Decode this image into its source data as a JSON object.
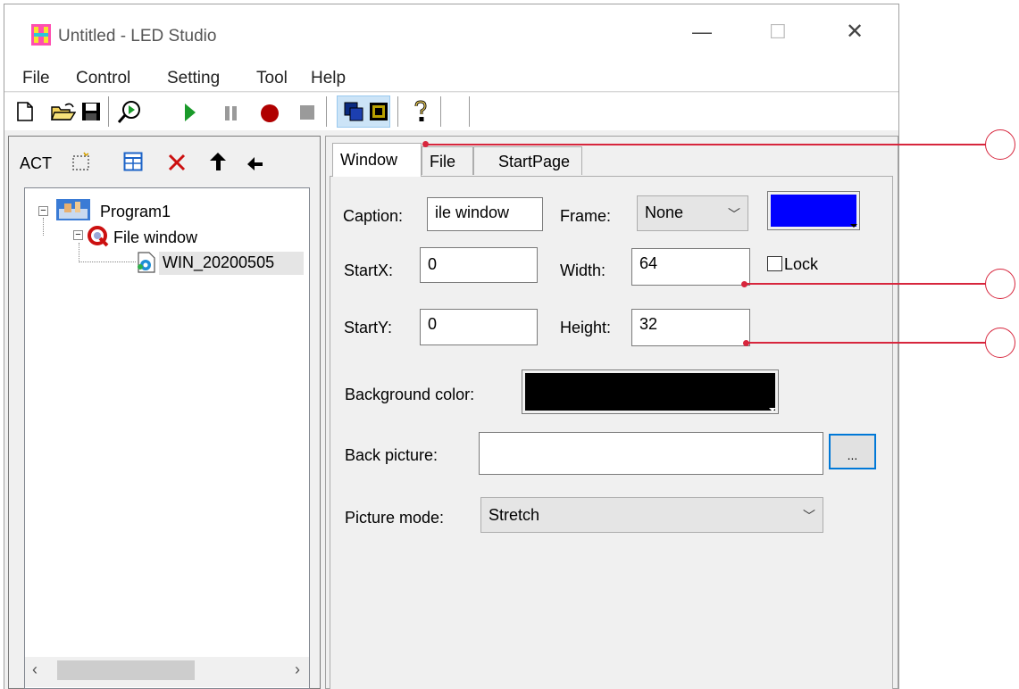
{
  "window": {
    "title": "Untitled - LED Studio",
    "minimize_glyph": "—",
    "maximize_glyph": "☐",
    "close_glyph": "✕"
  },
  "menu": [
    "File",
    "Control",
    "Setting",
    "Tool",
    "Help"
  ],
  "toolbar": {
    "icons": [
      "new-icon",
      "open-icon",
      "save-icon",
      "preview-icon",
      "play-icon",
      "pause-icon",
      "record-icon",
      "stop-icon",
      "window-mode-icon",
      "fullscreen-mode-icon",
      "help-icon"
    ]
  },
  "left_toolbar": {
    "act_label": "ACT",
    "icons": [
      "new-item-icon",
      "layout-icon",
      "delete-icon",
      "move-up-icon",
      "move-down-icon"
    ]
  },
  "tree": {
    "program": "Program1",
    "window": "File window",
    "file": "WIN_20200505"
  },
  "tabs": [
    "Window",
    "File",
    "StartPage"
  ],
  "form": {
    "caption_label": "Caption:",
    "caption_value": "ile window",
    "frame_label": "Frame:",
    "frame_value": "None",
    "frame_color": "#0000ff",
    "startx_label": "StartX:",
    "startx_value": "0",
    "width_label": "Width:",
    "width_value": "64",
    "lock_label": "Lock",
    "lock_checked": false,
    "starty_label": "StartY:",
    "starty_value": "0",
    "height_label": "Height:",
    "height_value": "32",
    "bgcolor_label": "Background color:",
    "bgcolor_value": "#000000",
    "backpic_label": "Back picture:",
    "backpic_value": "",
    "browse_label": "...",
    "picmode_label": "Picture mode:",
    "picmode_value": "Stretch"
  },
  "colors": {
    "accent_callout": "#d7263d",
    "play_green": "#1a9a2a",
    "record_red": "#b00000"
  }
}
